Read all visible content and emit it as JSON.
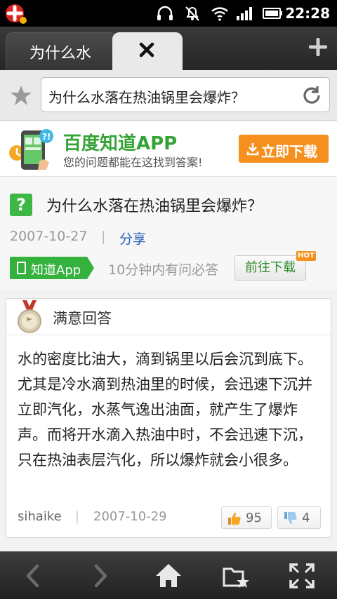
{
  "status_bar": {
    "time": "22:28",
    "icons": [
      "app-notification-icon",
      "headset-icon",
      "mute-icon",
      "wifi-icon",
      "signal-icon",
      "battery-icon"
    ]
  },
  "tabs": [
    {
      "label": "为什么水",
      "active": false
    },
    {
      "label": "",
      "active": true
    }
  ],
  "address_bar": {
    "url_text": "为什么水落在热油锅里会爆炸？"
  },
  "banner": {
    "title": "百度知道APP",
    "subtitle": "您的问题都能在这找到答案!",
    "download_label": "立即下载"
  },
  "question": {
    "title": "为什么水落在热油锅里会爆炸？",
    "date": "2007-10-27",
    "separator": "|",
    "share_label": "分享",
    "app_badge": "知道App",
    "promo_text": "10分钟内有问必答",
    "goto_download": "前往下载",
    "hot_tag": "HOT"
  },
  "answer": {
    "header": "满意回答",
    "body": "水的密度比油大，滴到锅里以后会沉到底下。尤其是冷水滴到热油里的时候，会迅速下沉并立即汽化，水蒸气逸出油面，就产生了爆炸声。而将开水滴入热油中时，不会迅速下沉，只在热油表层汽化，所以爆炸就会小很多。",
    "user": "sihaike",
    "separator": "|",
    "date": "2007-10-29",
    "upvotes": "95",
    "downvotes": "4"
  },
  "toolbar": {
    "buttons": [
      "back-icon",
      "forward-icon",
      "home-icon",
      "bookmarks-icon",
      "fullscreen-icon"
    ]
  },
  "colors": {
    "brand_green": "#35a335",
    "accent_orange": "#f5901e",
    "link_blue": "#2a63b8"
  }
}
